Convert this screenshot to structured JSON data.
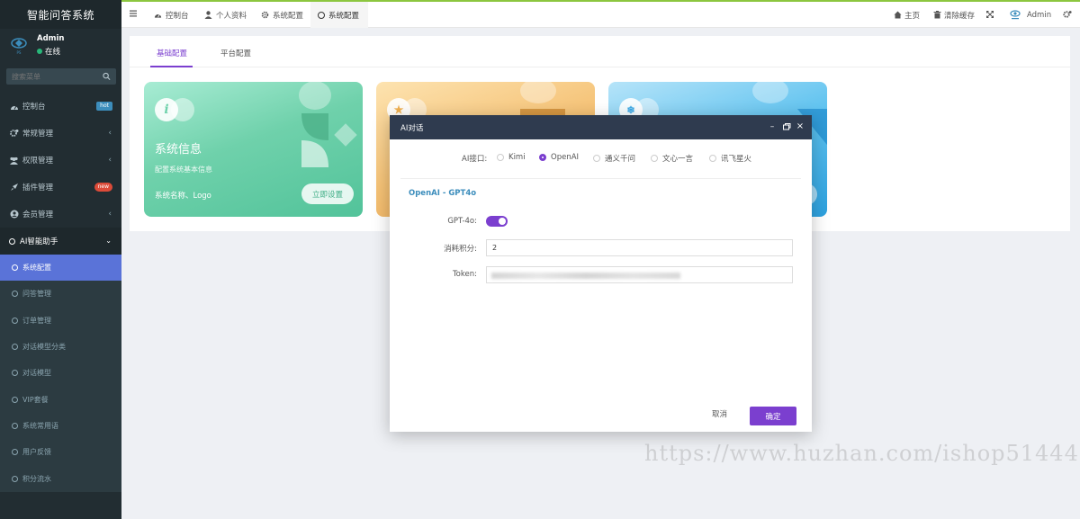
{
  "sidebar": {
    "brand": "智能问答系统",
    "user_name": "Admin",
    "user_status": "在线",
    "search_placeholder": "搜索菜单",
    "menu": [
      {
        "label": "控制台",
        "badge": "hot"
      },
      {
        "label": "常规管理"
      },
      {
        "label": "权限管理"
      },
      {
        "label": "插件管理",
        "badge": "new"
      },
      {
        "label": "会员管理"
      },
      {
        "label": "AI智能助手"
      }
    ],
    "submenu": [
      {
        "label": "系统配置"
      },
      {
        "label": "问答管理"
      },
      {
        "label": "订单管理"
      },
      {
        "label": "对话模型分类"
      },
      {
        "label": "对话模型"
      },
      {
        "label": "VIP套餐"
      },
      {
        "label": "系统常用语"
      },
      {
        "label": "用户反馈"
      },
      {
        "label": "积分流水"
      }
    ]
  },
  "topbar": {
    "tabs": [
      "控制台",
      "个人资料",
      "系统配置",
      "系统配置"
    ],
    "home": "主页",
    "clear_cache": "清除缓存",
    "admin": "Admin"
  },
  "panel": {
    "tabs": [
      "基础配置",
      "平台配置"
    ],
    "card1": {
      "title": "系统信息",
      "subtitle": "配置系统基本信息",
      "footer": "系统名称、Logo",
      "button": "立即设置"
    }
  },
  "modal": {
    "title": "AI对话",
    "api_label": "AI接口:",
    "options": [
      "Kimi",
      "OpenAI",
      "通义千问",
      "文心一言",
      "讯飞星火"
    ],
    "selected": "OpenAI",
    "section": "OpenAI - GPT4o",
    "gpt_label": "GPT-4o:",
    "points_label": "消耗积分:",
    "points_value": "2",
    "token_label": "Token:",
    "cancel": "取消",
    "confirm": "确定"
  },
  "watermark": "https://www.huzhan.com/ishop51444",
  "colors": {
    "sidebar_bg": "#222d32",
    "active_item": "#5a73d8",
    "accent": "#7b3fcf",
    "modal_header": "#2f3b4f",
    "section_title": "#3c8dbc"
  }
}
